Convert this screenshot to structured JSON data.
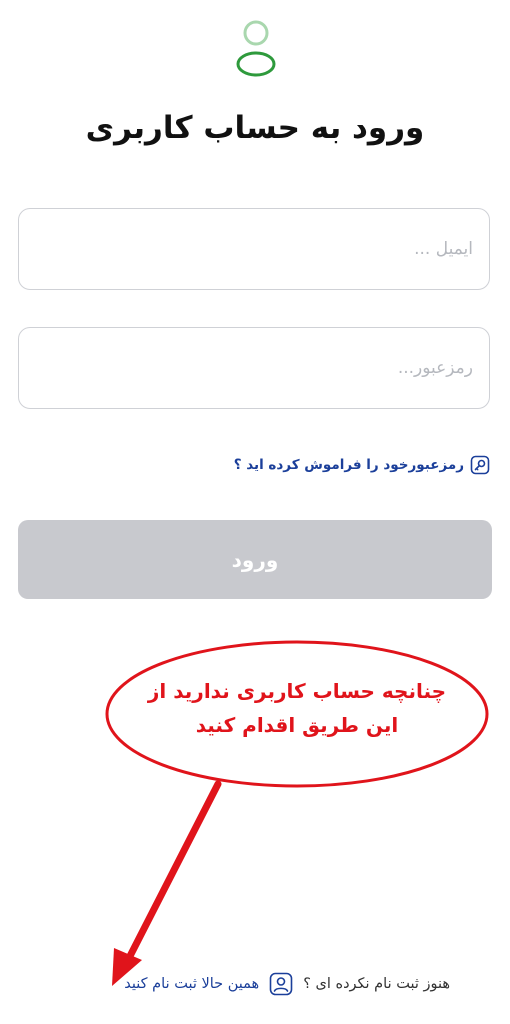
{
  "header": {
    "logo_icon": "user-avatar-icon",
    "title": "ورود به حساب کاربری"
  },
  "form": {
    "email_placeholder": "ایمیل ...",
    "password_placeholder": "رمزعبور...",
    "forgot_password_label": "رمزعبورخود را فراموش کرده اید ؟",
    "forgot_password_icon": "key-icon",
    "login_button_label": "ورود"
  },
  "annotation": {
    "line1": "چنانچه حساب کاربری ندارید از",
    "line2": "این طریق اقدام کنید",
    "color": "#e0141b"
  },
  "footer": {
    "question": "هنوز ثبت نام نکرده ای ؟",
    "user_icon": "user-icon",
    "register_link": "همین حالا ثبت نام کنید"
  },
  "colors": {
    "accent": "#1b3f9a",
    "logo_green": "#2e9a3c",
    "button_disabled": "#c8c9ce",
    "border": "#cfd1d6"
  }
}
